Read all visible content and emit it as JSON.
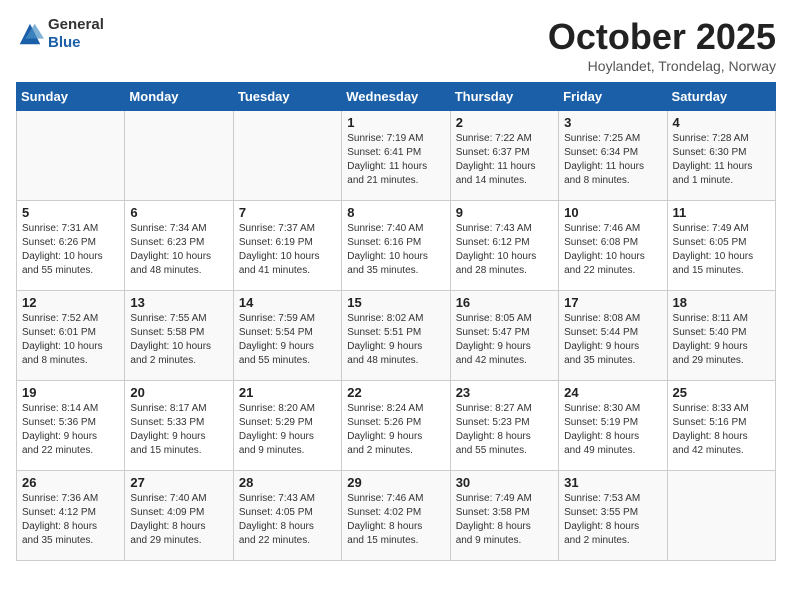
{
  "logo": {
    "text_general": "General",
    "text_blue": "Blue"
  },
  "header": {
    "month": "October 2025",
    "location": "Hoylandet, Trondelag, Norway"
  },
  "weekdays": [
    "Sunday",
    "Monday",
    "Tuesday",
    "Wednesday",
    "Thursday",
    "Friday",
    "Saturday"
  ],
  "weeks": [
    [
      {
        "day": "",
        "info": ""
      },
      {
        "day": "",
        "info": ""
      },
      {
        "day": "",
        "info": ""
      },
      {
        "day": "1",
        "info": "Sunrise: 7:19 AM\nSunset: 6:41 PM\nDaylight: 11 hours\nand 21 minutes."
      },
      {
        "day": "2",
        "info": "Sunrise: 7:22 AM\nSunset: 6:37 PM\nDaylight: 11 hours\nand 14 minutes."
      },
      {
        "day": "3",
        "info": "Sunrise: 7:25 AM\nSunset: 6:34 PM\nDaylight: 11 hours\nand 8 minutes."
      },
      {
        "day": "4",
        "info": "Sunrise: 7:28 AM\nSunset: 6:30 PM\nDaylight: 11 hours\nand 1 minute."
      }
    ],
    [
      {
        "day": "5",
        "info": "Sunrise: 7:31 AM\nSunset: 6:26 PM\nDaylight: 10 hours\nand 55 minutes."
      },
      {
        "day": "6",
        "info": "Sunrise: 7:34 AM\nSunset: 6:23 PM\nDaylight: 10 hours\nand 48 minutes."
      },
      {
        "day": "7",
        "info": "Sunrise: 7:37 AM\nSunset: 6:19 PM\nDaylight: 10 hours\nand 41 minutes."
      },
      {
        "day": "8",
        "info": "Sunrise: 7:40 AM\nSunset: 6:16 PM\nDaylight: 10 hours\nand 35 minutes."
      },
      {
        "day": "9",
        "info": "Sunrise: 7:43 AM\nSunset: 6:12 PM\nDaylight: 10 hours\nand 28 minutes."
      },
      {
        "day": "10",
        "info": "Sunrise: 7:46 AM\nSunset: 6:08 PM\nDaylight: 10 hours\nand 22 minutes."
      },
      {
        "day": "11",
        "info": "Sunrise: 7:49 AM\nSunset: 6:05 PM\nDaylight: 10 hours\nand 15 minutes."
      }
    ],
    [
      {
        "day": "12",
        "info": "Sunrise: 7:52 AM\nSunset: 6:01 PM\nDaylight: 10 hours\nand 8 minutes."
      },
      {
        "day": "13",
        "info": "Sunrise: 7:55 AM\nSunset: 5:58 PM\nDaylight: 10 hours\nand 2 minutes."
      },
      {
        "day": "14",
        "info": "Sunrise: 7:59 AM\nSunset: 5:54 PM\nDaylight: 9 hours\nand 55 minutes."
      },
      {
        "day": "15",
        "info": "Sunrise: 8:02 AM\nSunset: 5:51 PM\nDaylight: 9 hours\nand 48 minutes."
      },
      {
        "day": "16",
        "info": "Sunrise: 8:05 AM\nSunset: 5:47 PM\nDaylight: 9 hours\nand 42 minutes."
      },
      {
        "day": "17",
        "info": "Sunrise: 8:08 AM\nSunset: 5:44 PM\nDaylight: 9 hours\nand 35 minutes."
      },
      {
        "day": "18",
        "info": "Sunrise: 8:11 AM\nSunset: 5:40 PM\nDaylight: 9 hours\nand 29 minutes."
      }
    ],
    [
      {
        "day": "19",
        "info": "Sunrise: 8:14 AM\nSunset: 5:36 PM\nDaylight: 9 hours\nand 22 minutes."
      },
      {
        "day": "20",
        "info": "Sunrise: 8:17 AM\nSunset: 5:33 PM\nDaylight: 9 hours\nand 15 minutes."
      },
      {
        "day": "21",
        "info": "Sunrise: 8:20 AM\nSunset: 5:29 PM\nDaylight: 9 hours\nand 9 minutes."
      },
      {
        "day": "22",
        "info": "Sunrise: 8:24 AM\nSunset: 5:26 PM\nDaylight: 9 hours\nand 2 minutes."
      },
      {
        "day": "23",
        "info": "Sunrise: 8:27 AM\nSunset: 5:23 PM\nDaylight: 8 hours\nand 55 minutes."
      },
      {
        "day": "24",
        "info": "Sunrise: 8:30 AM\nSunset: 5:19 PM\nDaylight: 8 hours\nand 49 minutes."
      },
      {
        "day": "25",
        "info": "Sunrise: 8:33 AM\nSunset: 5:16 PM\nDaylight: 8 hours\nand 42 minutes."
      }
    ],
    [
      {
        "day": "26",
        "info": "Sunrise: 7:36 AM\nSunset: 4:12 PM\nDaylight: 8 hours\nand 35 minutes."
      },
      {
        "day": "27",
        "info": "Sunrise: 7:40 AM\nSunset: 4:09 PM\nDaylight: 8 hours\nand 29 minutes."
      },
      {
        "day": "28",
        "info": "Sunrise: 7:43 AM\nSunset: 4:05 PM\nDaylight: 8 hours\nand 22 minutes."
      },
      {
        "day": "29",
        "info": "Sunrise: 7:46 AM\nSunset: 4:02 PM\nDaylight: 8 hours\nand 15 minutes."
      },
      {
        "day": "30",
        "info": "Sunrise: 7:49 AM\nSunset: 3:58 PM\nDaylight: 8 hours\nand 9 minutes."
      },
      {
        "day": "31",
        "info": "Sunrise: 7:53 AM\nSunset: 3:55 PM\nDaylight: 8 hours\nand 2 minutes."
      },
      {
        "day": "",
        "info": ""
      }
    ]
  ]
}
